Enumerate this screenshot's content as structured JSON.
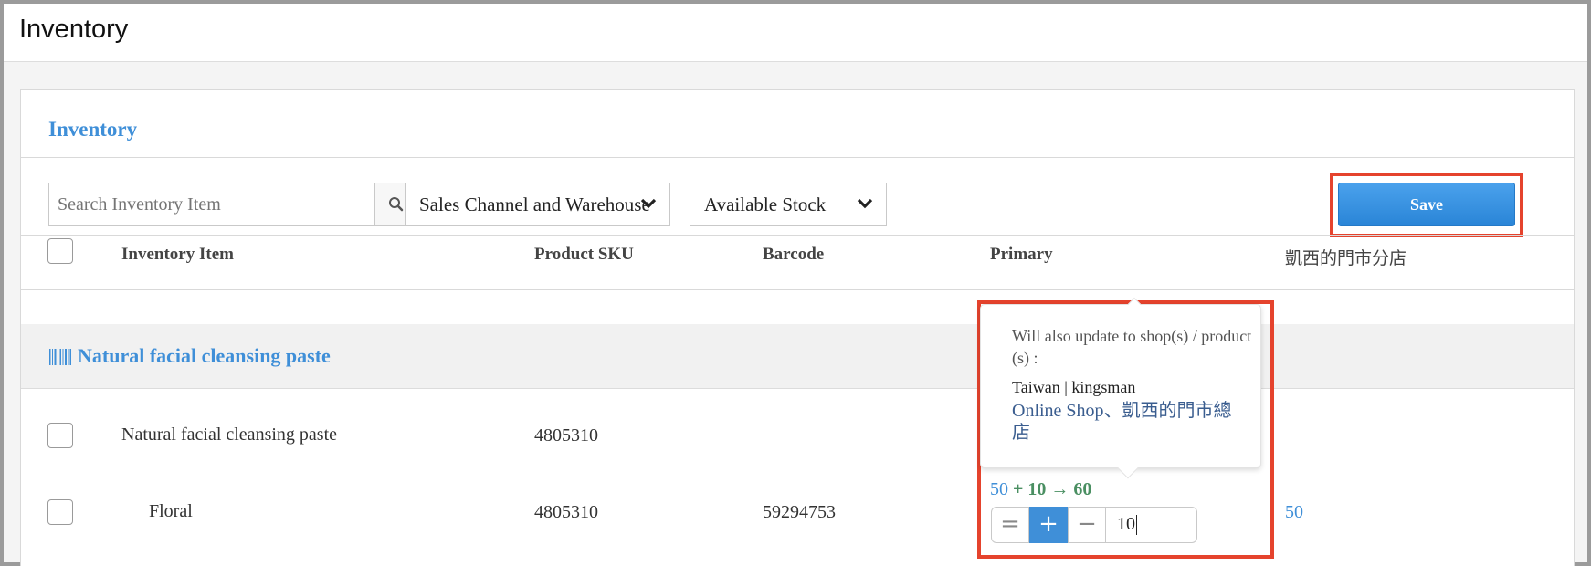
{
  "app": {
    "title": "Inventory"
  },
  "panel": {
    "title": "Inventory"
  },
  "toolbar": {
    "search_placeholder": "Search Inventory Item",
    "channel_select": "Sales Channel and Warehouse",
    "stock_select": "Available Stock",
    "save_label": "Save"
  },
  "table": {
    "headers": [
      "Inventory Item",
      "Product SKU",
      "Barcode",
      "Primary",
      "凱西的門市分店"
    ]
  },
  "group": {
    "title": "Natural facial cleansing paste"
  },
  "rows": [
    {
      "item": "Natural facial cleansing paste",
      "sku": "4805310",
      "barcode": "",
      "primary": "",
      "branch": ""
    },
    {
      "item": "Floral",
      "sku": "4805310",
      "barcode": "59294753",
      "primary": "",
      "branch": "50"
    }
  ],
  "popover": {
    "note": "Will also update to shop(s) / product (s) :",
    "shop": "Taiwan | kingsman",
    "products": "Online Shop、凱西的門市總店"
  },
  "adjust": {
    "old_value": "50",
    "operation": "+ 10 → 60",
    "modes": [
      "=",
      "+",
      "−"
    ],
    "active_mode": "+",
    "input_value": "10"
  },
  "colors": {
    "accent": "#3f8fd8",
    "highlight": "#e5432d",
    "result_green": "#4a8f62"
  }
}
